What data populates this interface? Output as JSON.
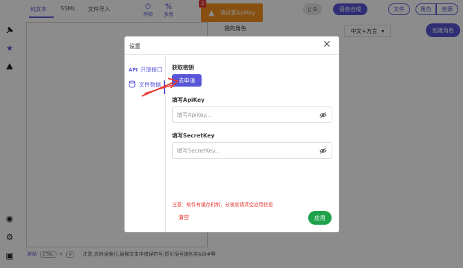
{
  "topbar": {
    "tabs": [
      "纯文本",
      "SSML",
      "文件导入"
    ],
    "tools": [
      {
        "icon": "pause-icon",
        "glyph": "⏱",
        "label": "停顿"
      },
      {
        "icon": "multi-tone-icon",
        "glyph": "%",
        "label": "多音"
      }
    ],
    "warning": {
      "badge": "2",
      "label": "请设置ApiKey"
    },
    "counter_label": "0",
    "synth_label": "语音合成",
    "file_label": "文件",
    "role_label": "角色",
    "voice_label": "音源"
  },
  "middle": {
    "title": "我的角色"
  },
  "right": {
    "dialect": "中文+方言",
    "create_role": "创建角色"
  },
  "bottom": {
    "label": "粘贴",
    "key1": "CTRL",
    "plus": "+",
    "key2": "V",
    "hint": "注意:去除误换行,替换文本中错误符号,短引括号被别名&@#等"
  },
  "modal": {
    "title": "设置",
    "close": "✕",
    "side": [
      {
        "prefix": "API",
        "label": "开放接口"
      },
      {
        "prefix": "",
        "label": "文件数据"
      }
    ],
    "get_key_label": "获取密钥",
    "apply_key_btn": "去申请",
    "api_key": {
      "label": "填写ApiKey",
      "placeholder": "填写ApiKey..."
    },
    "secret_key": {
      "label": "填写SecretKey",
      "placeholder": "填写SecretKey..."
    },
    "note": "注意：软件有缓存机制，分发前请清空应用信息",
    "clear": "清空",
    "apply": "应用"
  },
  "colors": {
    "accent": "#5856d6",
    "warning": "#f7931e",
    "danger": "#e53935",
    "success": "#1fa24a"
  }
}
